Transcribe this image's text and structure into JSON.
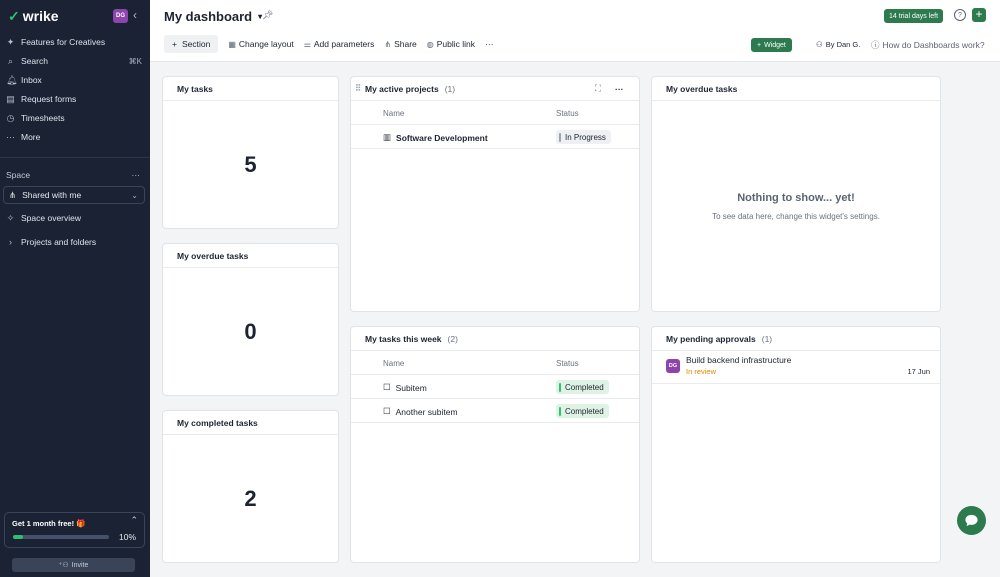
{
  "app": {
    "name": "wrike",
    "avatar_initials": "DG"
  },
  "sidebar": {
    "items": [
      {
        "label": "Features for Creatives",
        "icon": "sparkle-icon"
      },
      {
        "label": "Search",
        "icon": "search-icon",
        "shortcut": "⌘K"
      },
      {
        "label": "Inbox",
        "icon": "bell-icon"
      },
      {
        "label": "Request forms",
        "icon": "form-icon"
      },
      {
        "label": "Timesheets",
        "icon": "clock-icon"
      },
      {
        "label": "More",
        "icon": "more-icon"
      }
    ],
    "space_label": "Space",
    "space_selected": "Shared with me",
    "space_overview": "Space overview",
    "projects_folders": "Projects and folders",
    "promo": {
      "title": "Get 1 month free! 🎁",
      "progress_pct": 10,
      "progress_text": "10%"
    },
    "invite_label": "Invite"
  },
  "header": {
    "title": "My dashboard",
    "trial_badge": "14 trial days left",
    "toolbar": {
      "section": "Section",
      "change_layout": "Change layout",
      "add_parameters": "Add parameters",
      "share": "Share",
      "public_link": "Public link",
      "more": "···"
    },
    "widget_button": "Widget",
    "by_user": "By Dan G.",
    "how_do": "How do Dashboards work?"
  },
  "widgets": {
    "my_tasks": {
      "title": "My tasks",
      "value": "5"
    },
    "my_overdue_small": {
      "title": "My overdue tasks",
      "value": "0"
    },
    "my_completed": {
      "title": "My completed tasks",
      "value": "2"
    },
    "active_projects": {
      "title": "My active projects",
      "count": "(1)",
      "col_name": "Name",
      "col_status": "Status",
      "rows": [
        {
          "name": "Software Development",
          "status": "In Progress"
        }
      ]
    },
    "overdue_empty": {
      "title": "My overdue tasks",
      "empty_title": "Nothing to show... yet!",
      "empty_sub": "To see data here, change this widget's settings."
    },
    "tasks_week": {
      "title": "My tasks this week",
      "count": "(2)",
      "col_name": "Name",
      "col_status": "Status",
      "rows": [
        {
          "name": "Subitem",
          "status": "Completed"
        },
        {
          "name": "Another subitem",
          "status": "Completed"
        }
      ]
    },
    "pending_approvals": {
      "title": "My pending approvals",
      "count": "(1)",
      "items": [
        {
          "initials": "DG",
          "title": "Build backend infrastructure",
          "status": "In review",
          "date": "17 Jun"
        }
      ]
    }
  },
  "colors": {
    "brand_green": "#2d7a4e",
    "sidebar_bg": "#1a2233",
    "avatar_purple": "#8e44ad"
  }
}
